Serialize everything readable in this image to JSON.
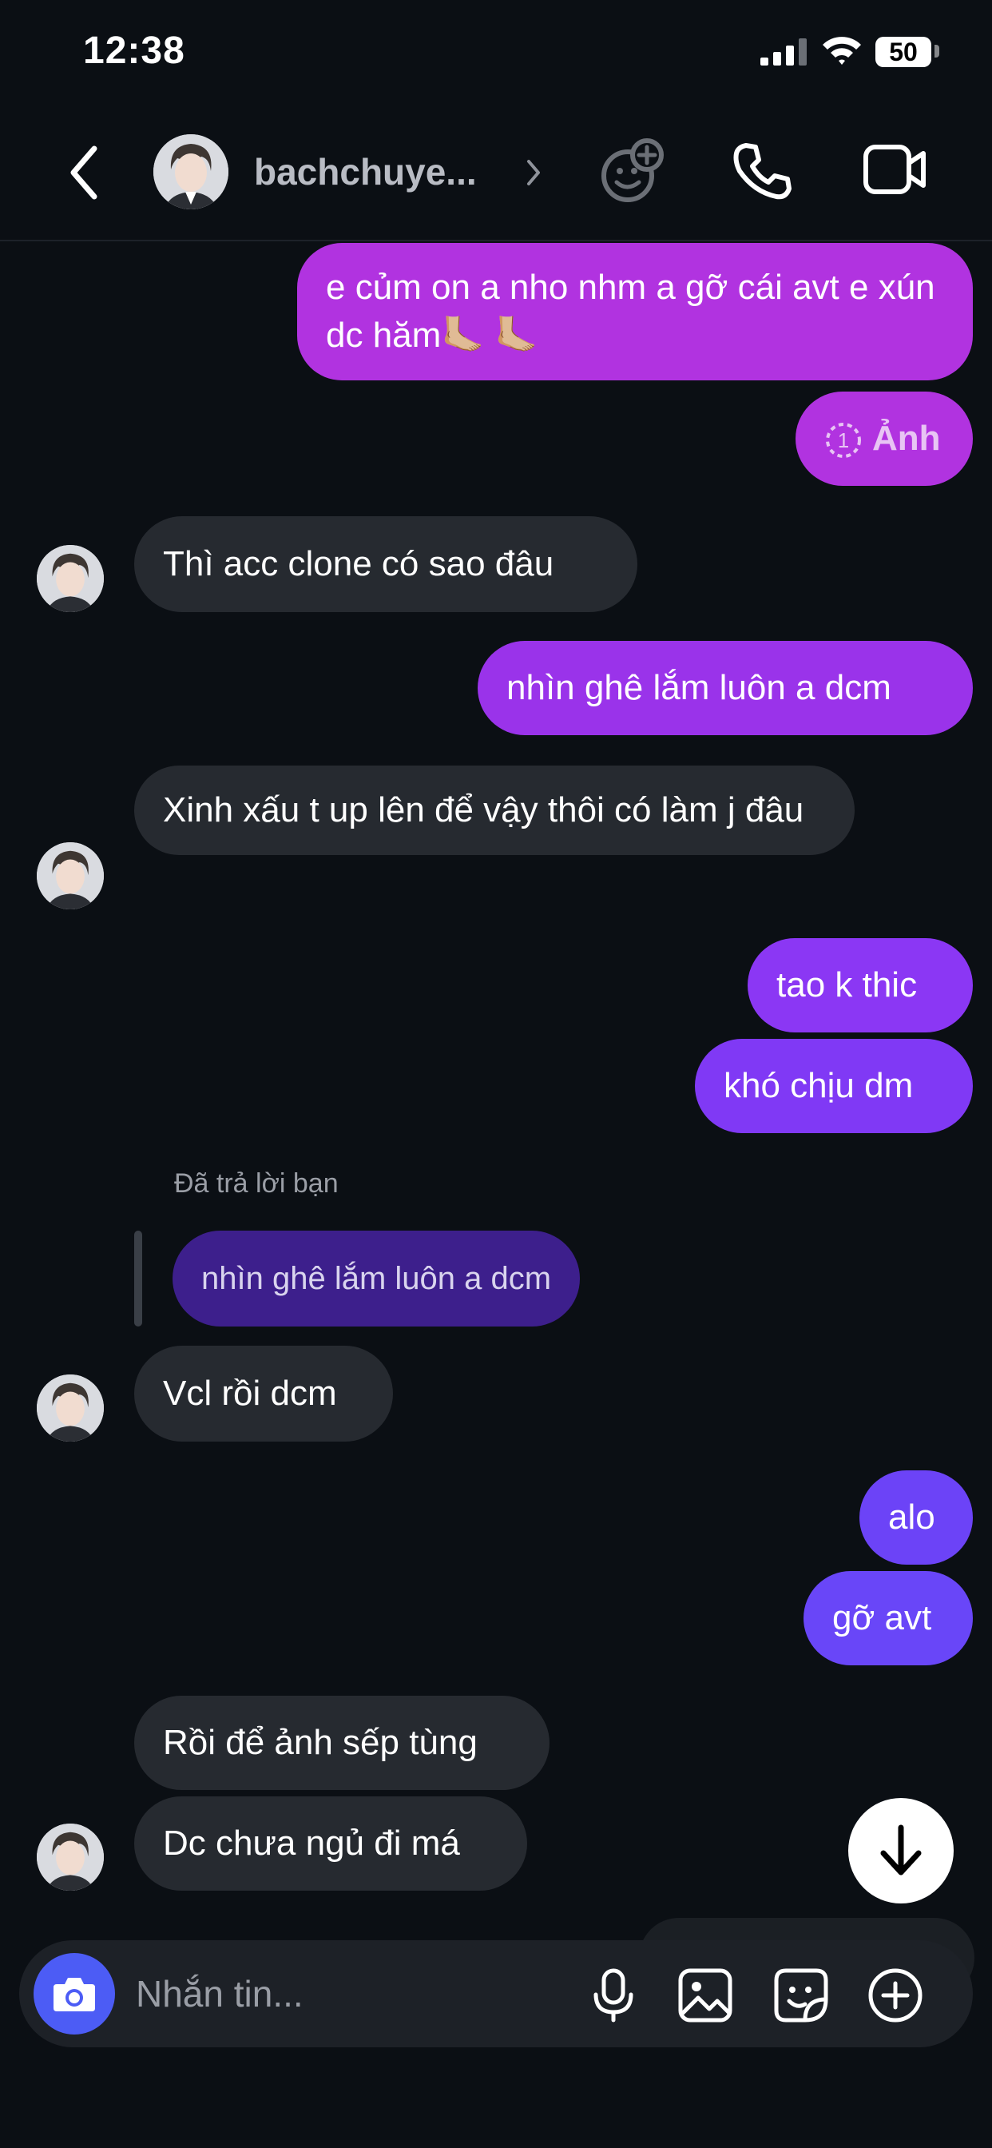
{
  "status_bar": {
    "time": "12:38",
    "battery": "50"
  },
  "header": {
    "username": "bachchuye..."
  },
  "messages": [
    {
      "direction": "out",
      "text": "e củm on a nho nhm a gỡ cái avt e xún dc hăm🦶🏼 🦶🏼"
    },
    {
      "direction": "out",
      "text": "Ảnh",
      "attachment_count": "1"
    },
    {
      "direction": "in",
      "text": "Thì acc clone có sao đâu"
    },
    {
      "direction": "out",
      "text": "nhìn ghê lắm luôn a dcm"
    },
    {
      "direction": "in",
      "text": "Xinh xấu t up lên để vậy thôi có làm j đâu"
    },
    {
      "direction": "out",
      "text": "tao k thic"
    },
    {
      "direction": "out",
      "text": "khó chịu dm"
    },
    {
      "direction": "in",
      "text": "Vcl rồi dcm"
    },
    {
      "direction": "out",
      "text": "alo"
    },
    {
      "direction": "out",
      "text": "gỡ avt"
    },
    {
      "direction": "in",
      "text": "Rồi để ảnh sếp tùng"
    },
    {
      "direction": "in",
      "text": "Dc chưa ngủ đi má"
    }
  ],
  "reply": {
    "label": "Đã trả lời bạn",
    "quoted": "nhìn ghê lắm luôn a dcm"
  },
  "composer": {
    "placeholder": "Nhắn tin..."
  },
  "icons": {
    "back": "chevron-left-icon",
    "chevron": "chevron-right-icon",
    "effects": "face-plus-icon",
    "call": "phone-icon",
    "video": "video-camera-icon",
    "camera": "camera-icon",
    "mic": "microphone-icon",
    "gallery": "image-icon",
    "sticker": "sticker-icon",
    "plus": "plus-circle-icon",
    "scroll": "arrow-down-icon"
  },
  "colors": {
    "background": "#0b0f14",
    "outgoing_top": "#b232e2",
    "outgoing_bottom": "#6f45f7",
    "incoming": "#262a30",
    "accent_camera": "#4c5cf5"
  }
}
